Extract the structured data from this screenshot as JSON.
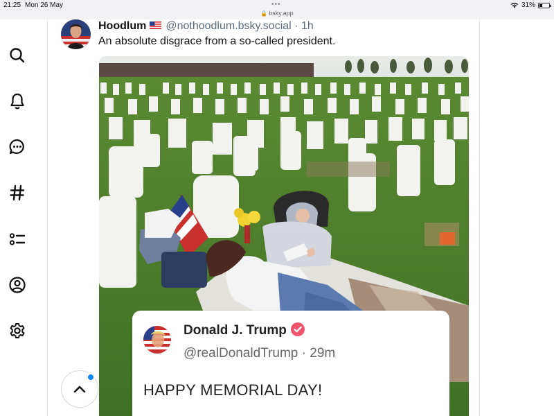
{
  "status_bar": {
    "time": "21:25",
    "date": "Mon 26 May",
    "url": "bsky.app",
    "battery": "31%"
  },
  "nav": {
    "items": [
      {
        "name": "search",
        "icon": "search-icon"
      },
      {
        "name": "notifications",
        "icon": "bell-icon"
      },
      {
        "name": "chat",
        "icon": "chat-icon"
      },
      {
        "name": "feeds",
        "icon": "hashtag-icon"
      },
      {
        "name": "lists",
        "icon": "list-icon"
      },
      {
        "name": "profile",
        "icon": "profile-icon"
      },
      {
        "name": "settings",
        "icon": "gear-icon"
      }
    ]
  },
  "post": {
    "author_name": "Hoodlum",
    "author_flag": "🇺🇸",
    "handle": "@nothoodlum.bsky.social",
    "separator": "·",
    "time_ago": "1h",
    "text": "An absolute disgrace from a so-called president."
  },
  "embedded_image": {
    "quote": {
      "name": "Donald J. Trump",
      "handle": "@realDonaldTrump",
      "separator": "·",
      "time_ago": "29m",
      "text": "HAPPY MEMORIAL DAY!"
    }
  },
  "colors": {
    "accent": "#1185fe",
    "verified": "#f0536c",
    "handle": "#5b6a7c",
    "grass": "#4b7a2c"
  }
}
